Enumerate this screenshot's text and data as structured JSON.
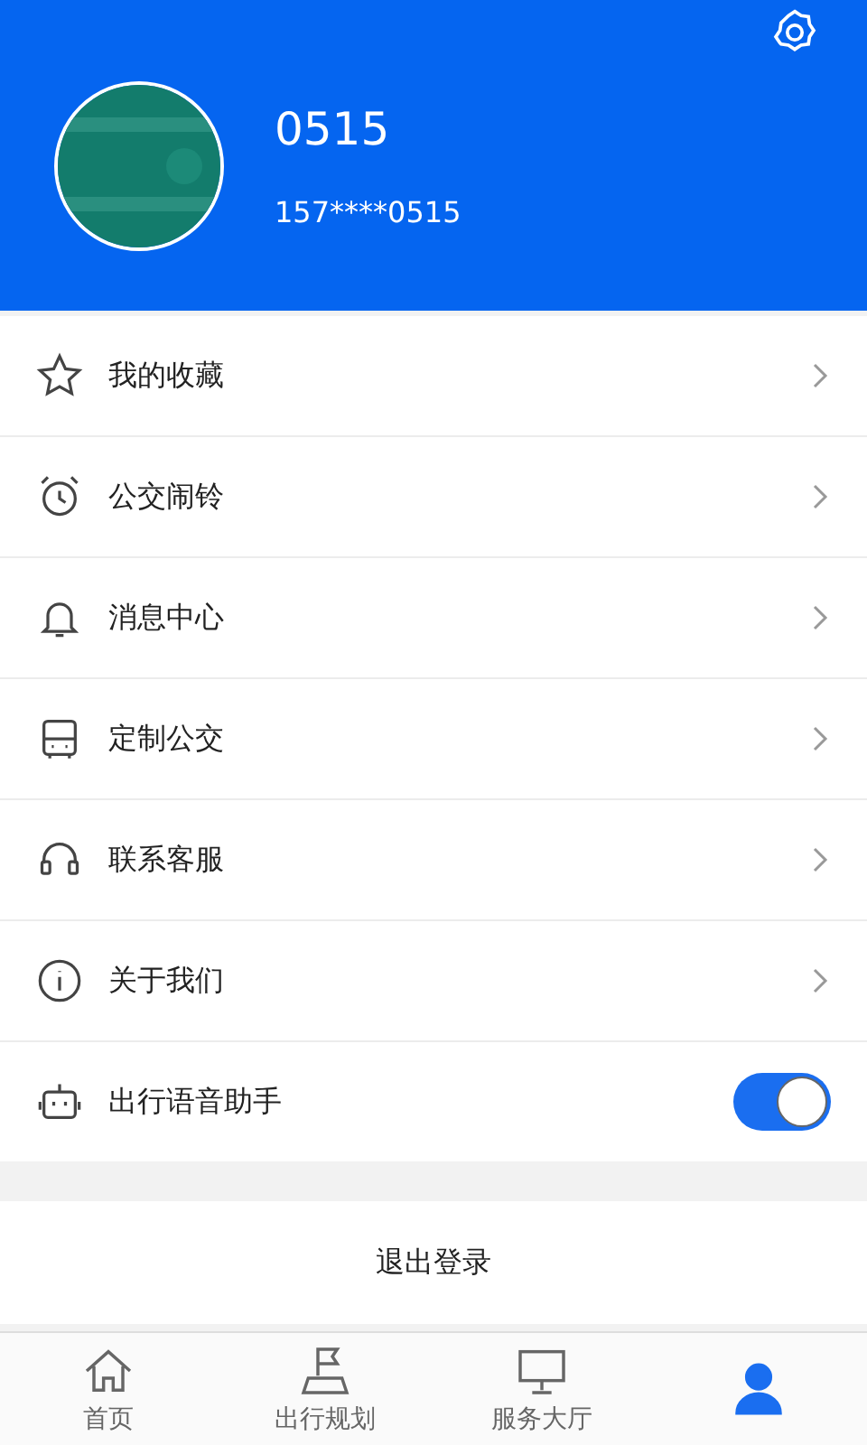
{
  "profile": {
    "name": "0515",
    "phone": "157****0515"
  },
  "menu": [
    {
      "kind": "link",
      "label": "我的收藏"
    },
    {
      "kind": "link",
      "label": "公交闹铃"
    },
    {
      "kind": "link",
      "label": "消息中心"
    },
    {
      "kind": "link",
      "label": "定制公交"
    },
    {
      "kind": "link",
      "label": "联系客服"
    },
    {
      "kind": "link",
      "label": "关于我们"
    },
    {
      "kind": "toggle",
      "label": "出行语音助手",
      "on": true
    }
  ],
  "logout": "退出登录",
  "tabs": [
    {
      "label": "首页",
      "selected": false
    },
    {
      "label": "出行规划",
      "selected": false
    },
    {
      "label": "服务大厅",
      "selected": false
    },
    {
      "selected": true
    }
  ]
}
